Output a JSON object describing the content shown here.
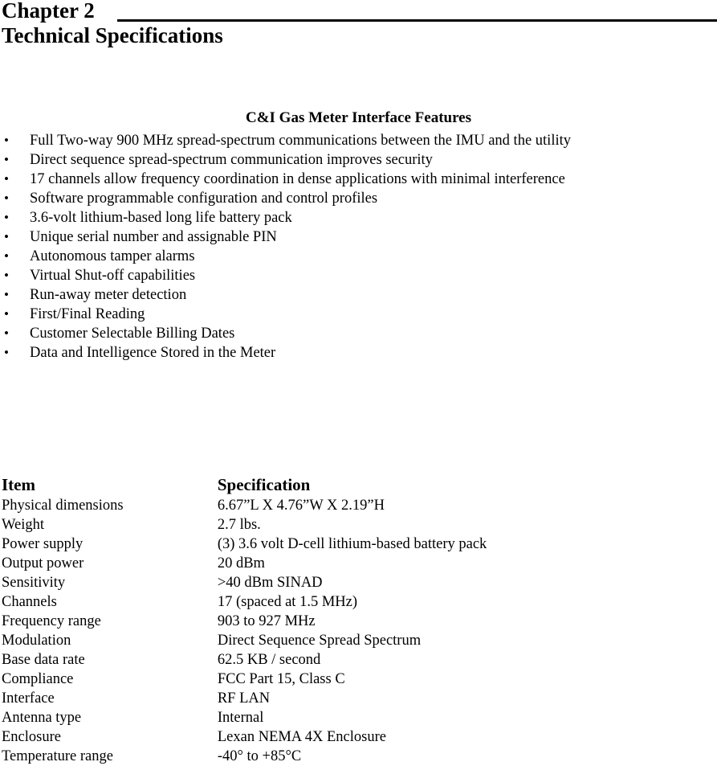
{
  "page": {
    "chapter_label": "Chapter 2",
    "chapter_subtitle": "Technical Specifications"
  },
  "features": {
    "heading": "C&I Gas Meter Interface Features",
    "bullet_glyph": "•",
    "items": [
      "Full Two-way 900 MHz spread-spectrum communications between the IMU and the utility",
      "Direct sequence spread-spectrum communication improves security",
      "17 channels allow frequency coordination in dense applications with minimal interference",
      "Software programmable configuration and control profiles",
      "3.6-volt lithium-based long life battery pack",
      "Unique serial number and assignable PIN",
      "Autonomous tamper alarms",
      "Virtual Shut-off capabilities",
      "Run-away meter detection",
      "First/Final Reading",
      "Customer Selectable Billing Dates",
      "Data and Intelligence Stored in the Meter"
    ]
  },
  "spec_table": {
    "headers": {
      "item": "Item",
      "specification": "Specification"
    },
    "rows": [
      {
        "item": "Physical dimensions",
        "specification": "6.67”L X 4.76”W X 2.19”H"
      },
      {
        "item": "Weight",
        "specification": "2.7 lbs."
      },
      {
        "item": "Power supply",
        "specification": "(3) 3.6 volt D-cell lithium-based battery pack"
      },
      {
        "item": "Output power",
        "specification": "20 dBm"
      },
      {
        "item": "Sensitivity",
        "specification": ">40 dBm SINAD"
      },
      {
        "item": "Channels",
        "specification": "17 (spaced at 1.5 MHz)"
      },
      {
        "item": "Frequency range",
        "specification": "903 to 927 MHz"
      },
      {
        "item": "Modulation",
        "specification": "Direct Sequence Spread Spectrum"
      },
      {
        "item": "Base data rate",
        "specification": "62.5 KB / second"
      },
      {
        "item": "Compliance",
        "specification": "FCC Part 15, Class C"
      },
      {
        "item": "Interface",
        "specification": "RF LAN"
      },
      {
        "item": "Antenna type",
        "specification": "Internal"
      },
      {
        "item": "Enclosure",
        "specification": "Lexan NEMA 4X Enclosure"
      },
      {
        "item": "Temperature range",
        "specification": "-40° to +85°C"
      }
    ]
  }
}
